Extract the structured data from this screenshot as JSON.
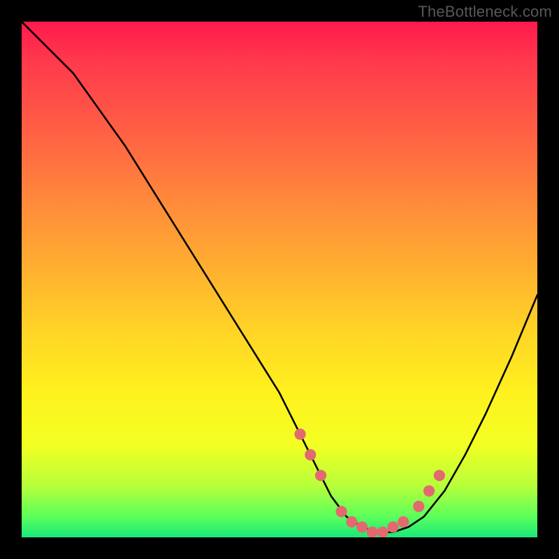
{
  "watermark": "TheBottleneck.com",
  "chart_data": {
    "type": "line",
    "title": "",
    "xlabel": "",
    "ylabel": "",
    "xlim": [
      0,
      100
    ],
    "ylim": [
      0,
      100
    ],
    "series": [
      {
        "name": "bottleneck-curve",
        "x": [
          0,
          5,
          10,
          15,
          20,
          25,
          30,
          35,
          40,
          45,
          50,
          55,
          58,
          60,
          63,
          66,
          69,
          72,
          75,
          78,
          82,
          86,
          90,
          95,
          100
        ],
        "y": [
          100,
          95,
          90,
          83,
          76,
          68,
          60,
          52,
          44,
          36,
          28,
          18,
          12,
          8,
          4,
          2,
          1,
          1,
          2,
          4,
          9,
          16,
          24,
          35,
          47
        ]
      }
    ],
    "markers": {
      "name": "highlight-points",
      "color": "#e26a6f",
      "x": [
        54,
        56,
        58,
        62,
        64,
        66,
        68,
        70,
        72,
        74,
        77,
        79,
        81
      ],
      "y": [
        20,
        16,
        12,
        5,
        3,
        2,
        1,
        1,
        2,
        3,
        6,
        9,
        12
      ]
    },
    "gradient_stops": [
      {
        "pos": 0.0,
        "color": "#ff1a4d"
      },
      {
        "pos": 0.35,
        "color": "#ff8a3b"
      },
      {
        "pos": 0.72,
        "color": "#fff11e"
      },
      {
        "pos": 1.0,
        "color": "#19e87a"
      }
    ]
  }
}
